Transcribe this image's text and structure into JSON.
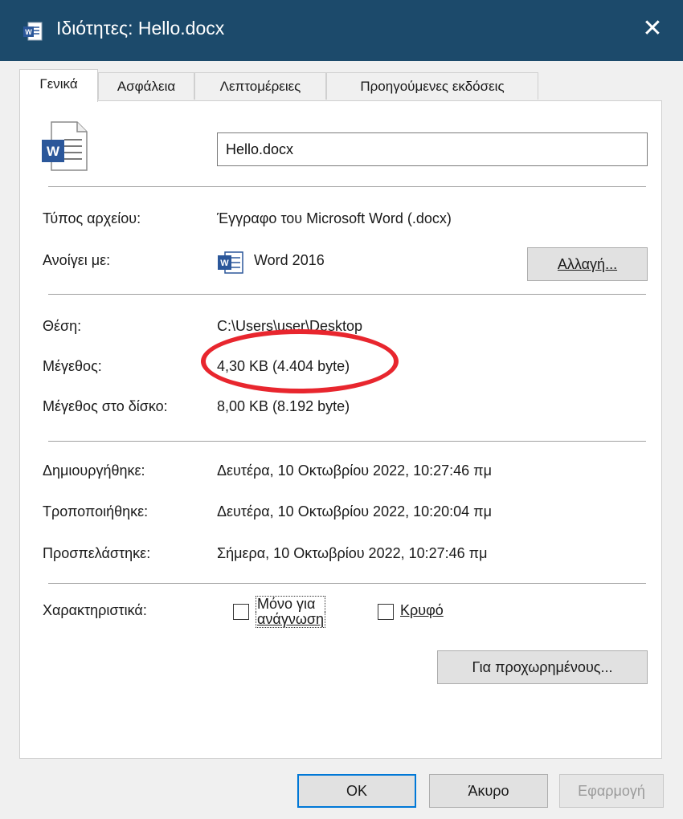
{
  "window": {
    "title": "Ιδιότητες: Hello.docx",
    "close_label": "✕",
    "app_icon": "word-doc-icon"
  },
  "tabs": [
    {
      "label": "Γενικά",
      "active": true
    },
    {
      "label": "Ασφάλεια",
      "active": false
    },
    {
      "label": "Λεπτομέρειες",
      "active": false
    },
    {
      "label": "Προηγούμενες εκδόσεις",
      "active": false
    }
  ],
  "general": {
    "file_name": "Hello.docx",
    "file_type_label": "Τύπος αρχείου:",
    "file_type_value": "Έγγραφο του Microsoft Word (.docx)",
    "opens_with_label": "Ανοίγει με:",
    "opens_with_value": "Word 2016",
    "change_button": "Αλλαγή...",
    "location_label": "Θέση:",
    "location_value": "C:\\Users\\user\\Desktop",
    "size_label": "Μέγεθος:",
    "size_value": "4,30 KB (4.404 byte)",
    "size_on_disk_label": "Μέγεθος στο δίσκο:",
    "size_on_disk_value": "8,00 KB (8.192 byte)",
    "created_label": "Δημιουργήθηκε:",
    "created_value": "Δευτέρα, 10 Οκτωβρίου 2022, 10:27:46 πμ",
    "modified_label": "Τροποποιήθηκε:",
    "modified_value": "Δευτέρα, 10 Οκτωβρίου 2022, 10:20:04 πμ",
    "accessed_label": "Προσπελάστηκε:",
    "accessed_value": "Σήμερα, 10 Οκτωβρίου 2022, 10:27:46 πμ",
    "attributes_label": "Χαρακτηριστικά:",
    "readonly_label_line1": "Μόνο για",
    "readonly_label_line2": "ανάγνωση",
    "readonly_checked": false,
    "hidden_label": "Κρυφό",
    "hidden_checked": false,
    "advanced_button": "Για προχωρημένους..."
  },
  "footer": {
    "ok": "OK",
    "cancel": "Άκυρο",
    "apply": "Εφαρμογή"
  },
  "colors": {
    "titlebar": "#1c4a6b",
    "highlight_ring": "#e8262e",
    "word_blue": "#2b579a",
    "focus_blue": "#0078d7"
  }
}
